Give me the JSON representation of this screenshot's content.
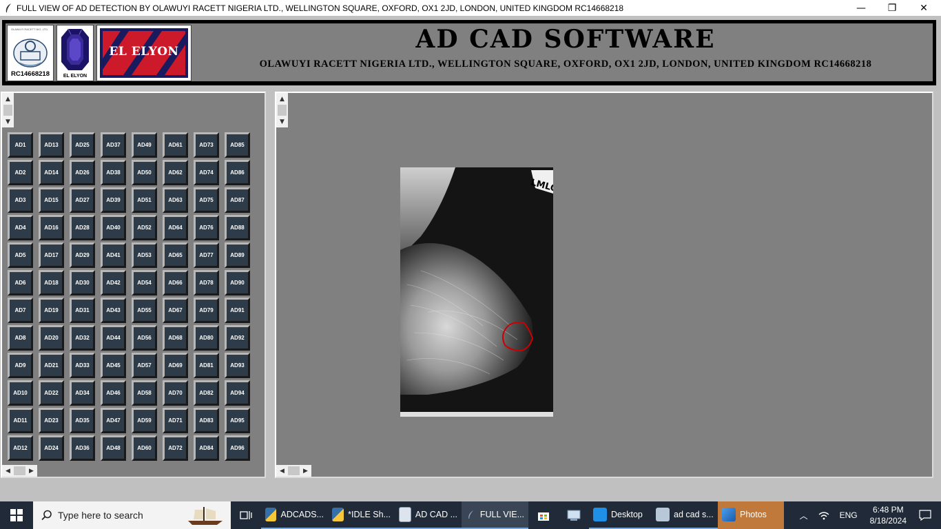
{
  "window": {
    "title": "FULL VIEW OF AD DETECTION BY OLAWUYI RACETT NIGERIA LTD., WELLINGTON SQUARE, OXFORD, OX1 2JD, LONDON, UNITED KINGDOM RC14668218",
    "minimize": "—",
    "maximize": "❐",
    "close": "✕"
  },
  "header": {
    "title": "AD CAD SOFTWARE",
    "subtitle": "OLAWUYI RACETT NIGERIA LTD., WELLINGTON SQUARE, OXFORD, OX1 2JD, LONDON, UNITED KINGDOM RC14668218",
    "logo1_caption": "RC14668218",
    "logo1_top_text": "OLAWUYI RACETT NIG. LTD.",
    "logo2_caption": "EL ELYON",
    "logo3_text": "EL ELYON"
  },
  "ad_buttons": [
    "AD1",
    "AD2",
    "AD3",
    "AD4",
    "AD5",
    "AD6",
    "AD7",
    "AD8",
    "AD9",
    "AD10",
    "AD11",
    "AD12",
    "AD13",
    "AD14",
    "AD15",
    "AD16",
    "AD17",
    "AD18",
    "AD19",
    "AD20",
    "AD21",
    "AD22",
    "AD23",
    "AD24",
    "AD25",
    "AD26",
    "AD27",
    "AD28",
    "AD29",
    "AD30",
    "AD31",
    "AD32",
    "AD33",
    "AD34",
    "AD35",
    "AD36",
    "AD37",
    "AD38",
    "AD39",
    "AD40",
    "AD41",
    "AD42",
    "AD43",
    "AD44",
    "AD45",
    "AD46",
    "AD47",
    "AD48",
    "AD49",
    "AD50",
    "AD51",
    "AD52",
    "AD53",
    "AD54",
    "AD55",
    "AD56",
    "AD57",
    "AD58",
    "AD59",
    "AD60",
    "AD61",
    "AD62",
    "AD63",
    "AD64",
    "AD65",
    "AD66",
    "AD67",
    "AD68",
    "AD69",
    "AD70",
    "AD71",
    "AD72",
    "AD73",
    "AD74",
    "AD75",
    "AD76",
    "AD77",
    "AD78",
    "AD79",
    "AD80",
    "AD81",
    "AD82",
    "AD83",
    "AD84",
    "AD85",
    "AD86",
    "AD87",
    "AD88",
    "AD89",
    "AD90",
    "AD91",
    "AD92",
    "AD93",
    "AD94",
    "AD95",
    "AD96"
  ],
  "image": {
    "marker_label": "LMLO"
  },
  "taskbar": {
    "search_placeholder": "Type here to search",
    "apps": [
      {
        "label": "ADCADS..."
      },
      {
        "label": "*IDLE Sh..."
      },
      {
        "label": "AD CAD ..."
      },
      {
        "label": "FULL VIE..."
      },
      {
        "label": "Desktop"
      },
      {
        "label": "ad cad s..."
      },
      {
        "label": "Photos"
      }
    ],
    "language": "ENG",
    "time": "6:48 PM",
    "date": "8/18/2024"
  },
  "colors": {
    "panel_gray": "#808080",
    "button_face": "#2e3b48",
    "contour_red": "#cc0000",
    "taskbar": "#202a38"
  }
}
